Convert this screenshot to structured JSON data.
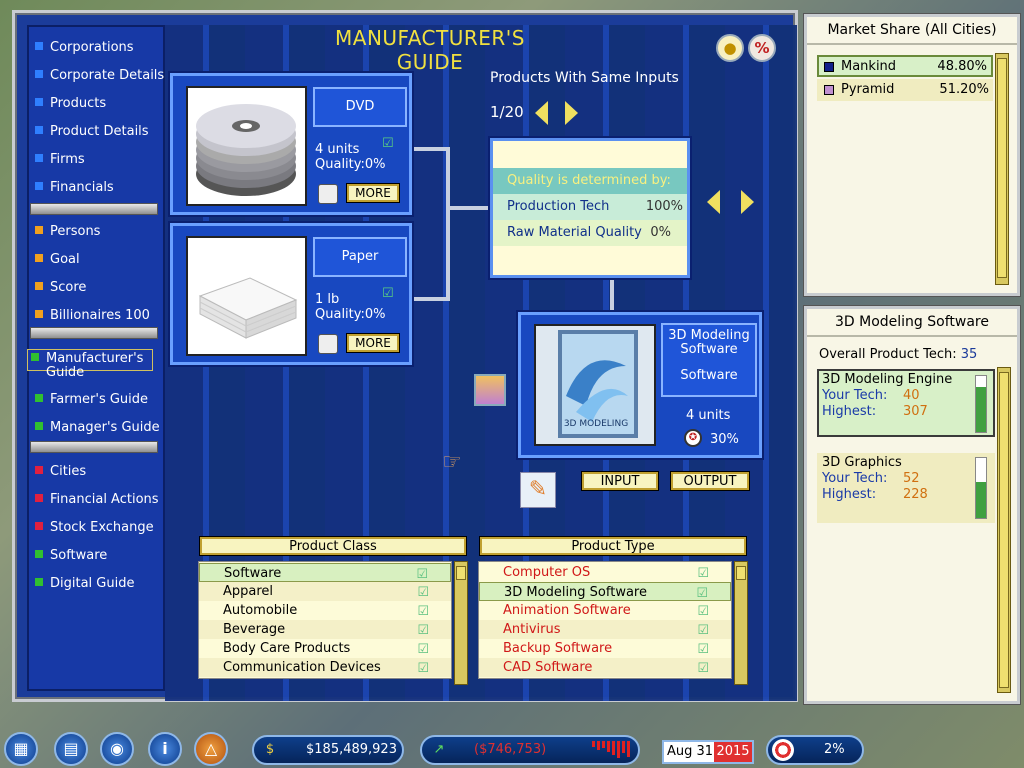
{
  "title": "MANUFACTURER'S GUIDE",
  "menu": {
    "items": [
      {
        "label": "Corporations",
        "bullet": "#2f7fff"
      },
      {
        "label": "Corporate Details",
        "bullet": "#2f7fff"
      },
      {
        "label": "Products",
        "bullet": "#2f7fff"
      },
      {
        "label": "Product Details",
        "bullet": "#2f7fff"
      },
      {
        "label": "Firms",
        "bullet": "#2f7fff"
      },
      {
        "label": "Financials",
        "bullet": "#2f7fff"
      },
      {
        "label": "Persons",
        "bullet": "#f0a020"
      },
      {
        "label": "Goal",
        "bullet": "#f0a020"
      },
      {
        "label": "Score",
        "bullet": "#f0a020"
      },
      {
        "label": "Billionaires 100",
        "bullet": "#f0a020"
      },
      {
        "label": "Manufacturer's Guide",
        "bullet": "#30c030"
      },
      {
        "label": "Farmer's Guide",
        "bullet": "#30c030"
      },
      {
        "label": "Manager's Guide",
        "bullet": "#30c030"
      },
      {
        "label": "Cities",
        "bullet": "#e02040"
      },
      {
        "label": "Financial Actions",
        "bullet": "#e02040"
      },
      {
        "label": "Stock Exchange",
        "bullet": "#e02040"
      },
      {
        "label": "Software",
        "bullet": "#30c030"
      },
      {
        "label": "Digital Guide",
        "bullet": "#30c030"
      }
    ]
  },
  "inputs": [
    {
      "name": "DVD",
      "amount": "4 units",
      "quality": "Quality:0%",
      "more": "MORE",
      "image": "dvd-stack-image"
    },
    {
      "name": "Paper",
      "amount": "1 lb",
      "quality": "Quality:0%",
      "more": "MORE",
      "image": "paper-stack-image"
    }
  ],
  "same_inputs": {
    "label": "Products With Same Inputs",
    "page": "1/20"
  },
  "quality": {
    "heading": "Quality is determined by:",
    "rows": [
      {
        "label": "Production Tech",
        "value": "100%"
      },
      {
        "label": "Raw Material Quality",
        "value": "0%"
      }
    ]
  },
  "output": {
    "name": "3D Modeling Software",
    "category": "Software",
    "amount": "4 units",
    "quality": "30%",
    "box_text": "3D MODELING"
  },
  "buttons": {
    "input": "INPUT",
    "output": "OUTPUT"
  },
  "product_class": {
    "header": "Product Class",
    "items": [
      "Software",
      "Apparel",
      "Automobile",
      "Beverage",
      "Body Care Products",
      "Communication Devices"
    ],
    "selected": 0
  },
  "product_type": {
    "header": "Product Type",
    "items": [
      {
        "label": "Computer OS",
        "color": "#d01818"
      },
      {
        "label": "3D Modeling Software",
        "color": "#000000"
      },
      {
        "label": "Animation Software",
        "color": "#d01818"
      },
      {
        "label": "Antivirus",
        "color": "#d01818"
      },
      {
        "label": "Backup Software",
        "color": "#d01818"
      },
      {
        "label": "CAD Software",
        "color": "#d01818"
      }
    ],
    "selected": 1
  },
  "market_share": {
    "title": "Market Share (All Cities)",
    "rows": [
      {
        "name": "Mankind",
        "value": "48.80%",
        "color": "#10208a"
      },
      {
        "name": "Pyramid",
        "value": "51.20%",
        "color": "#c090d0"
      }
    ]
  },
  "tech_panel": {
    "title": "3D Modeling Software",
    "overall_label": "Overall Product Tech:",
    "overall_value": "35",
    "your_tech_label": "Your Tech:",
    "highest_label": "Highest:",
    "techs": [
      {
        "name": "3D Modeling Engine",
        "your": "40",
        "highest": "307",
        "fill": 0.8
      },
      {
        "name": "3D Graphics",
        "your": "52",
        "highest": "228",
        "fill": 0.6
      }
    ]
  },
  "status": {
    "cash": "$185,489,923",
    "profit": "($746,753)",
    "date_month": "Aug 31",
    "date_year": "2015",
    "rate": "2%"
  },
  "colors": {
    "accent_yellow": "#f0e040",
    "panel_blue": "#1848c0",
    "profit_red": "#e03030"
  }
}
